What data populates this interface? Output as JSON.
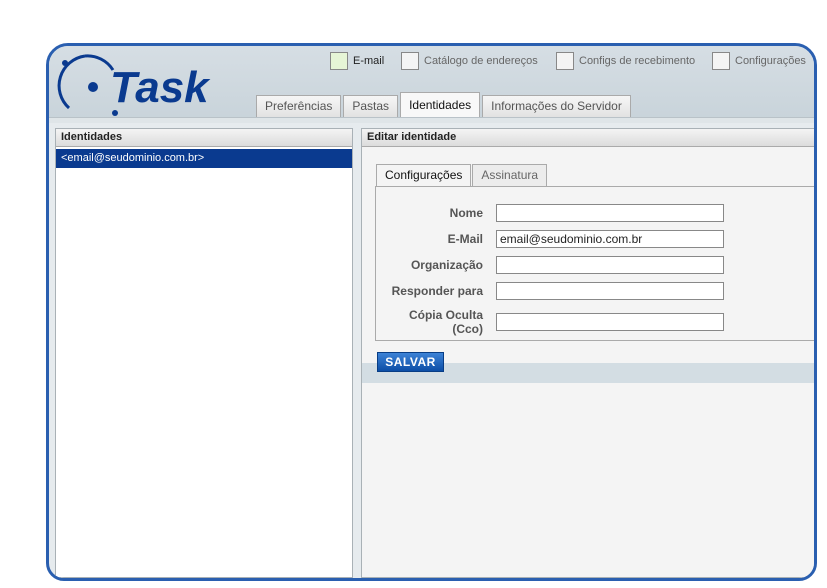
{
  "toolbar": {
    "items": [
      {
        "label": "E-mail",
        "icon": "email-inbox-icon"
      },
      {
        "label": "Catálogo de endereços",
        "icon": "address-book-icon"
      },
      {
        "label": "Configs de recebimento",
        "icon": "receive-settings-icon"
      },
      {
        "label": "Configurações",
        "icon": "settings-icon"
      }
    ]
  },
  "tabs": [
    {
      "label": "Preferências"
    },
    {
      "label": "Pastas"
    },
    {
      "label": "Identidades"
    },
    {
      "label": "Informações do Servidor"
    }
  ],
  "left": {
    "title": "Identidades",
    "items": [
      "<email@seudominio.com.br>"
    ]
  },
  "right": {
    "title": "Editar identidade",
    "tabs": [
      "Configurações",
      "Assinatura"
    ],
    "fields": [
      {
        "label": "Nome",
        "value": ""
      },
      {
        "label": "E-Mail",
        "value": "email@seudominio.com.br"
      },
      {
        "label": "Organização",
        "value": ""
      },
      {
        "label": "Responder para",
        "value": ""
      },
      {
        "label": "Cópia Oculta (Cco)",
        "value": ""
      }
    ],
    "save_label": "SALVAR"
  },
  "colors": {
    "brand": "#0a3a8f",
    "border": "#2a5fb0"
  }
}
